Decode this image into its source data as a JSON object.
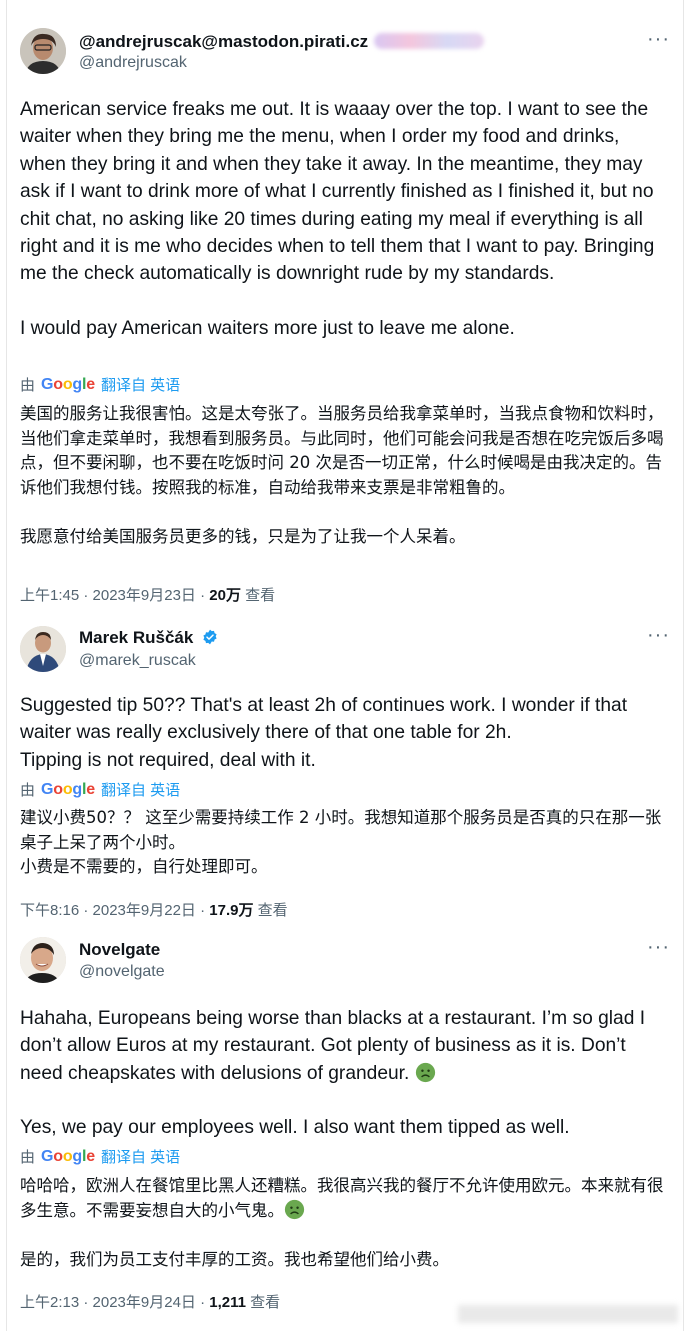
{
  "tweets": [
    {
      "name": "@andrejruscak@mastodon.pirati.cz",
      "handle": "@andrejruscak",
      "more": "···",
      "body_en": [
        "American service freaks me out. It is waaay over the top. I want to see the waiter when they bring me the menu, when I order my food and drinks, when they bring it and when they take it away. In the meantime, they may ask if I want to drink more of what I currently finished as I finished it, but no chit chat, no asking like 20 times during eating my meal if everything is all right and it is me who decides when to tell them that I want to pay. Bringing me the check automatically is downright rude by my standards.",
        "I would pay American waiters more just to leave me alone."
      ],
      "translate_by": "由",
      "translate_brand": "Google",
      "translate_label": "翻译自 英语",
      "body_zh": [
        "美国的服务让我很害怕。这是太夸张了。当服务员给我拿菜单时，当我点食物和饮料时，当他们拿走菜单时，我想看到服务员。与此同时，他们可能会问我是否想在吃完饭后多喝点，但不要闲聊，也不要在吃饭时问 20 次是否一切正常，什么时候喝是由我决定的。告诉他们我想付钱。按照我的标准，自动给我带来支票是非常粗鲁的。",
        "我愿意付给美国服务员更多的钱，只是为了让我一个人呆着。"
      ],
      "time": "上午1:45 · 2023年9月23日 · ",
      "views": "20万",
      "views_label": " 查看"
    },
    {
      "name": "Marek Ruščák",
      "handle": "@marek_ruscak",
      "more": "···",
      "body_en": [
        "Suggested tip 50?? That's at least 2h of continues work. I wonder if that waiter was really exclusively there of that one table for 2h.",
        "Tipping is not required, deal with it."
      ],
      "translate_by": "由",
      "translate_brand": "Google",
      "translate_label": "翻译自 英语",
      "body_zh": [
        "建议小费50？？ 这至少需要持续工作 2 小时。我想知道那个服务员是否真的只在那一张桌子上呆了两个小时。",
        "小费是不需要的，自行处理即可。"
      ],
      "time": "下午8:16 · 2023年9月22日 · ",
      "views": "17.9万",
      "views_label": " 查看"
    },
    {
      "name": "Novelgate",
      "handle": "@novelgate",
      "more": "···",
      "body_en": [
        "Hahaha, Europeans being worse than blacks at a restaurant. I’m so glad I don’t allow Euros at my restaurant. Got plenty of business as it is. Don’t need cheapskates with delusions of grandeur.",
        "Yes, we pay our employees well. I also want them tipped as well."
      ],
      "translate_by": "由",
      "translate_brand": "Google",
      "translate_label": "翻译自 英语",
      "body_zh": [
        "哈哈哈，欧洲人在餐馆里比黑人还糟糕。我很高兴我的餐厅不允许使用欧元。本来就有很多生意。不需要妄想自大的小气鬼。",
        "是的，我们为员工支付丰厚的工资。我也希望他们给小费。"
      ],
      "time": "上午2:13 · 2023年9月24日 · ",
      "views": "1,211",
      "views_label": " 查看"
    }
  ],
  "colors": {
    "text": "#0f1419",
    "muted": "#536471",
    "link": "#1d9bf0",
    "verified": "#1d9bf0"
  }
}
